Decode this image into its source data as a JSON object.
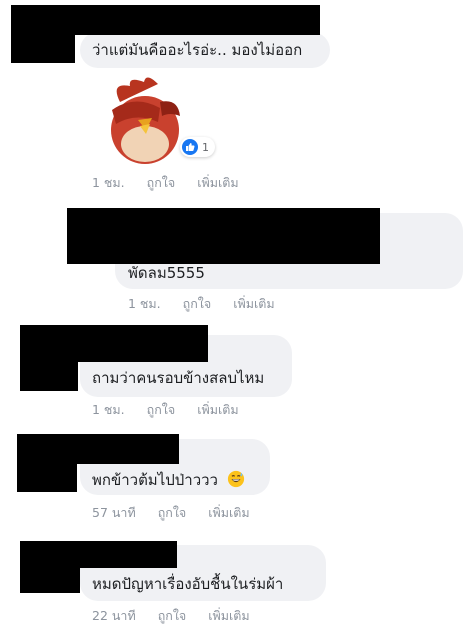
{
  "comments": [
    {
      "text": "ว่าแต่มันคืออะไรอ่ะ.. มองไม่ออก",
      "time": "1 ชม.",
      "like": "ถูกใจ",
      "more": "เพิ่มเติม",
      "reaction_count": "1",
      "sticker": "angry-bird-facepalm-sticker"
    },
    {
      "text": "พัดลม5555",
      "time": "1 ชม.",
      "like": "ถูกใจ",
      "more": "เพิ่มเติม"
    },
    {
      "text": "ถามว่าคนรอบข้างสลบไหม",
      "time": "1 ชม.",
      "like": "ถูกใจ",
      "more": "เพิ่มเติม"
    },
    {
      "text": "พกข้าวต้มไปป่าววว",
      "emoji": "grinning-sweat-emoji",
      "time": "57 นาที",
      "like": "ถูกใจ",
      "more": "เพิ่มเติม"
    },
    {
      "text": "หมดปัญหาเรื่องอับชื้นในร่มผ้า",
      "time": "22 นาที",
      "like": "ถูกใจ",
      "more": "เพิ่มเติม"
    }
  ],
  "colors": {
    "bubble": "#f0f1f4",
    "meta": "#8d949e",
    "like_blue": "#1877f2",
    "redaction": "#000000"
  }
}
